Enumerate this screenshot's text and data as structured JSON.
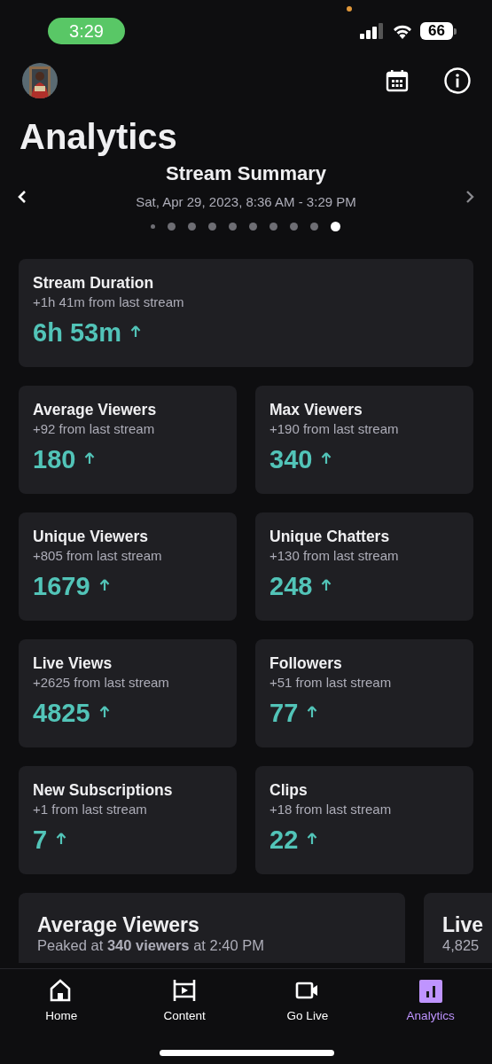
{
  "status_bar": {
    "time": "3:29",
    "battery": "66"
  },
  "header": {
    "title": "Analytics"
  },
  "summary": {
    "title": "Stream Summary",
    "date_range": "Sat, Apr 29, 2023, 8:36 AM - 3:29 PM",
    "pages": [
      {
        "selected": false
      },
      {
        "selected": false
      },
      {
        "selected": false
      },
      {
        "selected": false
      },
      {
        "selected": false
      },
      {
        "selected": false
      },
      {
        "selected": false
      },
      {
        "selected": false
      },
      {
        "selected": false
      },
      {
        "selected": true
      }
    ]
  },
  "metrics": [
    {
      "kind": "wide",
      "label": "Stream Duration",
      "change": "+1h 41m from last stream",
      "value": "6h 53m",
      "rising": true
    },
    {
      "kind": "half",
      "label": "Average Viewers",
      "change": "+92 from last stream",
      "value": "180",
      "rising": true
    },
    {
      "kind": "half",
      "label": "Max Viewers",
      "change": "+190 from last stream",
      "value": "340",
      "rising": true
    },
    {
      "kind": "half",
      "label": "Unique Viewers",
      "change": "+805 from last stream",
      "value": "1679",
      "rising": true
    },
    {
      "kind": "half",
      "label": "Unique Chatters",
      "change": "+130 from last stream",
      "value": "248",
      "rising": true
    },
    {
      "kind": "half",
      "label": "Live Views",
      "change": "+2625 from last stream",
      "value": "4825",
      "rising": true
    },
    {
      "kind": "half",
      "label": "Followers",
      "change": "+51 from last stream",
      "value": "77",
      "rising": true
    },
    {
      "kind": "half",
      "label": "New Subscriptions",
      "change": "+1 from last stream",
      "value": "7",
      "rising": true
    },
    {
      "kind": "half",
      "label": "Clips",
      "change": "+18 from last stream",
      "value": "22",
      "rising": true
    }
  ],
  "chart_cards": [
    {
      "title": "Average Viewers",
      "subtitle": "Peaked at **340 viewers** at 2:40 PM"
    },
    {
      "title": "Live",
      "subtitle": "4,825"
    }
  ],
  "tab_bar": [
    {
      "kind": "home",
      "label": "Home",
      "selected": false
    },
    {
      "kind": "content",
      "label": "Content",
      "selected": false
    },
    {
      "kind": "golive",
      "label": "Go Live",
      "selected": false
    },
    {
      "kind": "analytics",
      "label": "Analytics",
      "selected": true
    }
  ]
}
